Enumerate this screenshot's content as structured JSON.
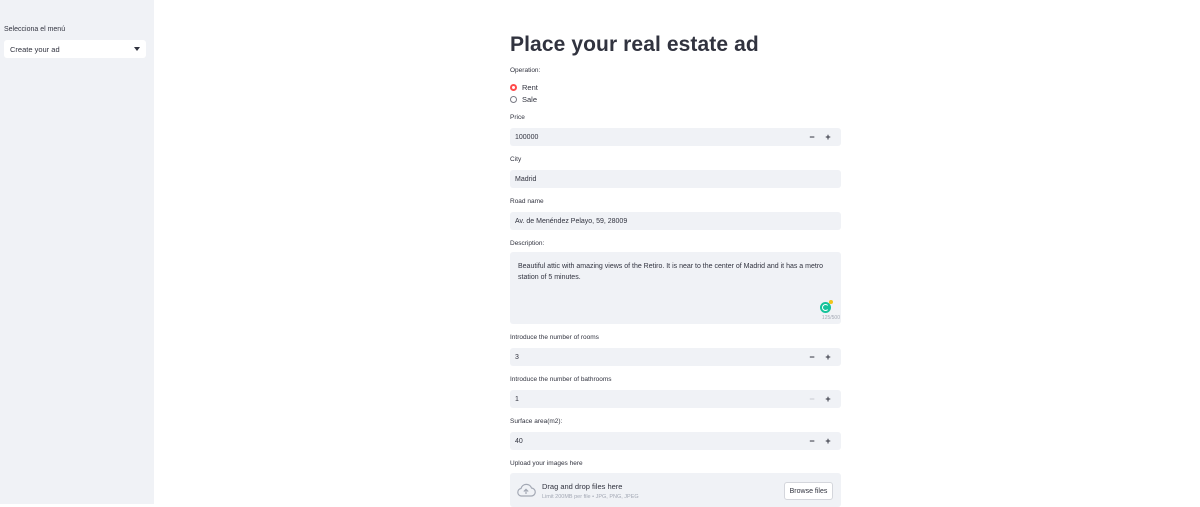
{
  "sidebar": {
    "label": "Selecciona el menú",
    "selected": "Create your ad"
  },
  "main": {
    "title": "Place your real estate ad",
    "operation": {
      "label": "Operation:",
      "options": [
        "Rent",
        "Sale"
      ],
      "selected": "Rent"
    },
    "price": {
      "label": "Price",
      "value": "100000"
    },
    "city": {
      "label": "City",
      "value": "Madrid"
    },
    "road": {
      "label": "Road name",
      "value": "Av. de Menéndez Pelayo, 59, 28009"
    },
    "description": {
      "label": "Description:",
      "value": "Beautiful attic with amazing views of the Retiro. It is near to the center of Madrid and it has a metro station of 5 minutes.",
      "counter": "125/500"
    },
    "rooms": {
      "label": "Introduce the number of rooms",
      "value": "3"
    },
    "bathrooms": {
      "label": "Introduce the number of bathrooms",
      "value": "1"
    },
    "surface": {
      "label": "Surface area(m2):",
      "value": "40"
    },
    "upload": {
      "label": "Upload your images here",
      "title": "Drag and drop files here",
      "limit": "Limit 200MB per file • JPG, PNG, JPEG",
      "button": "Browse files"
    },
    "stepper": {
      "minus": "−",
      "plus": "+"
    }
  },
  "colors": {
    "accent": "#ff4b4b",
    "sidebar_bg": "#f0f2f6",
    "field_bg": "#f0f2f6",
    "text": "#31333f"
  },
  "icons": [
    "chevron-down-icon",
    "cloud-upload-icon",
    "grammarly-icon"
  ]
}
